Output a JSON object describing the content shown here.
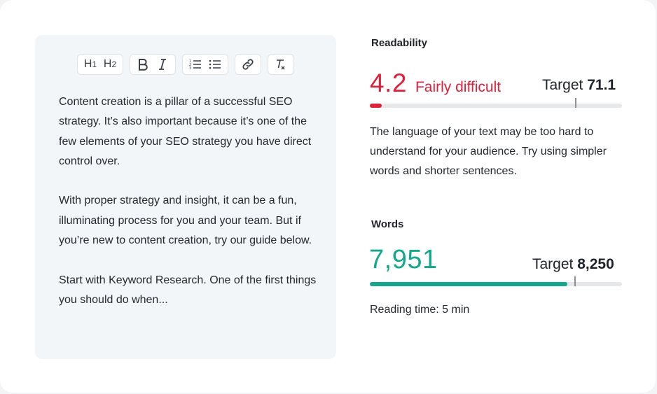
{
  "toolbar": {
    "groups": [
      [
        {
          "icon": "heading-1-icon",
          "label": "H1"
        },
        {
          "icon": "heading-2-icon",
          "label": "H2"
        }
      ],
      [
        {
          "icon": "bold-icon",
          "label": "B"
        },
        {
          "icon": "italic-icon",
          "label": "I"
        }
      ],
      [
        {
          "icon": "ordered-list-icon"
        },
        {
          "icon": "bullet-list-icon"
        }
      ],
      [
        {
          "icon": "link-icon"
        }
      ],
      [
        {
          "icon": "clear-format-icon"
        }
      ]
    ]
  },
  "editor": {
    "paragraphs": [
      "Content creation is a pillar of a successful SEO strategy. It’s also important because it’s one of the few elements of your SEO strategy you have direct control over.",
      "With proper strategy and insight, it can be a fun, illuminating process for you and your team. But if you’re new to content creation, try our guide below.",
      "Start with Keyword Research. One of the first things you should do when..."
    ]
  },
  "readability": {
    "title": "Readability",
    "score": "4.2",
    "label": "Fairly difficult",
    "target_label": "Target",
    "target_value": "71.1",
    "progress_fraction": 0.059,
    "target_fraction": 1.0,
    "color": "#e0203a",
    "description": "The language of your text may be too hard to understand for your audience. Try using simpler words and shorter sentences."
  },
  "words": {
    "title": "Words",
    "count": "7,951",
    "target_label": "Target",
    "target_value": "8,250",
    "progress_fraction": 0.9638,
    "color": "#13a88d",
    "reading_time": "Reading time: 5 min"
  }
}
